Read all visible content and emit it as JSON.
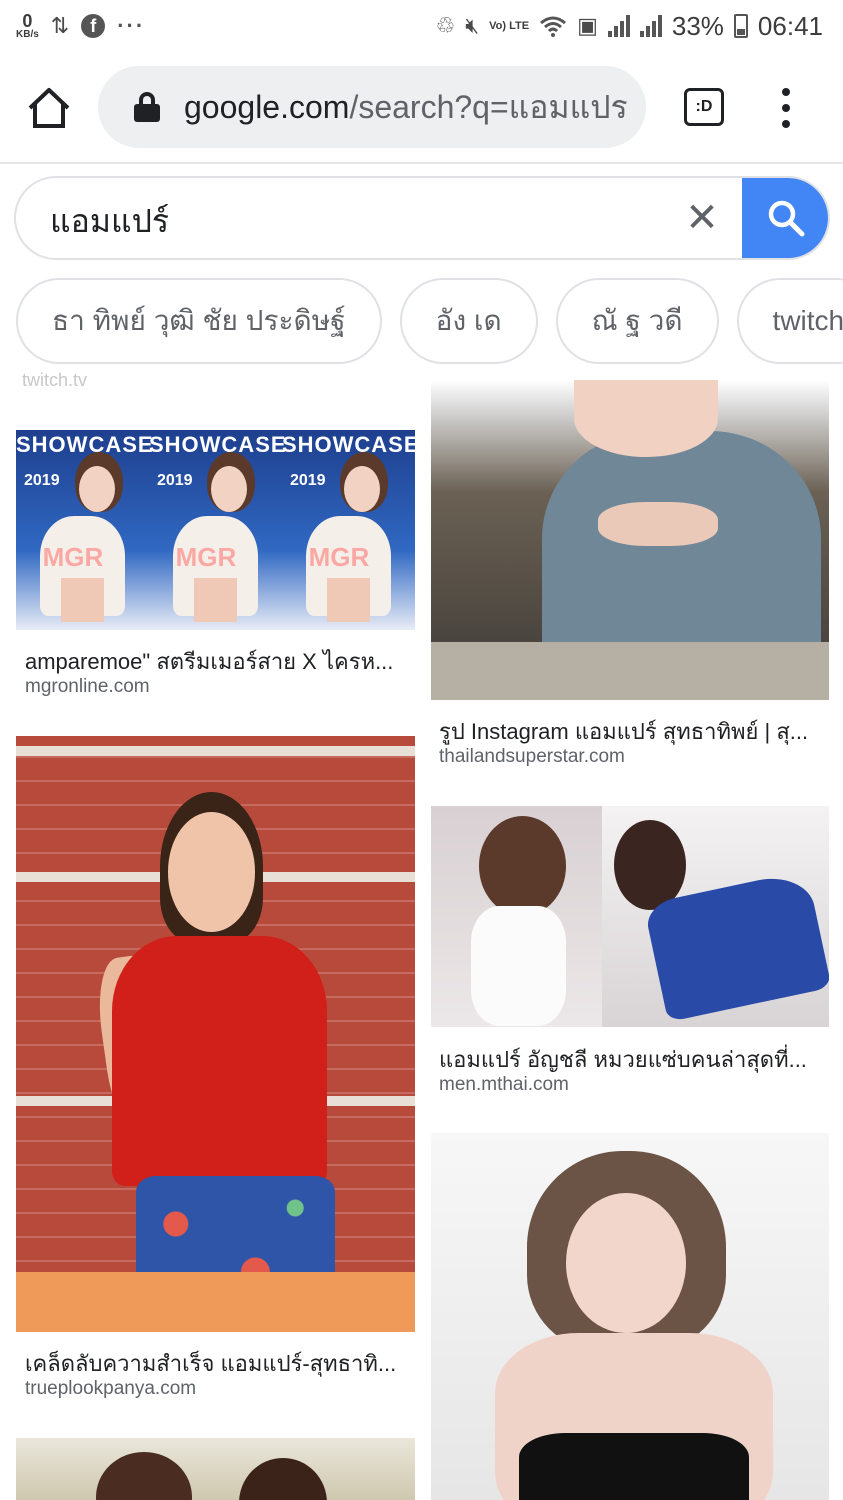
{
  "status_bar": {
    "speed_value": "0",
    "speed_unit": "KB/s",
    "volte": "Vo) LTE",
    "battery": "33%",
    "time": "06:41",
    "icons": [
      "data-transfer-icon",
      "facebook-icon",
      "more-notifications-icon",
      "nfc-icon",
      "mute-icon",
      "volte-icon",
      "wifi-icon",
      "sim-icon",
      "signal-icon",
      "battery-icon"
    ]
  },
  "browser": {
    "url_host": "google.com",
    "url_path": "/search?q=แอมแปร",
    "tab_label": ":D",
    "icons": [
      "home-icon",
      "lock-icon",
      "tab-switcher-icon",
      "more-vert-icon"
    ]
  },
  "search": {
    "query": "แอมแปร์",
    "clear_glyph": "✕",
    "icons": [
      "close-icon",
      "search-icon"
    ],
    "accent_color": "#4285f4"
  },
  "chips": [
    "ธา ทิพย์ วุฒิ ชัย ประดิษฐ์",
    "อัง เด",
    "ณั ฐ วดี",
    "twitch"
  ],
  "faded_source": "twitch.tv",
  "results": [
    {
      "caption": "amparemoe\" สตรีมเมอร์สาย X ไครห...",
      "source": "mgronline.com",
      "image_text": "SHOWCASE",
      "image_year": "2019",
      "image_logo": "MGR"
    },
    {
      "caption": "รูป Instagram แอมแปร์ สุทธาทิพย์ | สุ...",
      "source": "thailandsuperstar.com"
    },
    {
      "caption": "เคล็ดลับความสำเร็จ แอมแปร์-สุทธาทิ...",
      "source": "trueplookpanya.com"
    },
    {
      "caption": "แอมแปร์ อัญชลี หมวยแซ่บคนล่าสุดที่...",
      "source": "men.mthai.com"
    },
    {
      "caption": "",
      "source": ""
    },
    {
      "caption": "",
      "source": ""
    }
  ]
}
